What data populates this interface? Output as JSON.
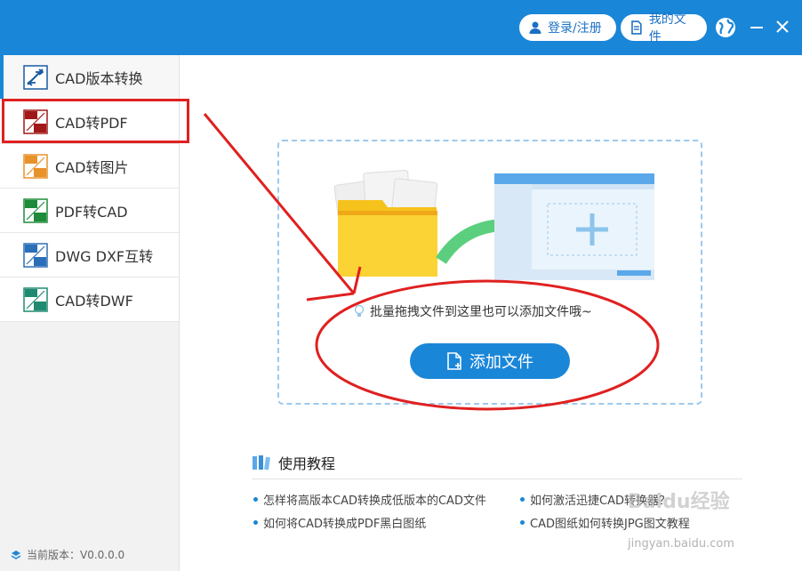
{
  "header": {
    "login_label": "登录/注册",
    "files_label": "我的文件",
    "accent_color": "#1a86d8"
  },
  "sidebar": {
    "items": [
      {
        "label": "CAD版本转换",
        "icon": "cad-version-icon"
      },
      {
        "label": "CAD转PDF",
        "icon": "cad-pdf-icon"
      },
      {
        "label": "CAD转图片",
        "icon": "cad-image-icon"
      },
      {
        "label": "PDF转CAD",
        "icon": "pdf-cad-icon"
      },
      {
        "label": "DWG DXF互转",
        "icon": "dwg-dxf-icon"
      },
      {
        "label": "CAD转DWF",
        "icon": "cad-dwf-icon"
      }
    ],
    "version_text": "当前版本：V0.0.0.0"
  },
  "main": {
    "drop_hint": "批量拖拽文件到这里也可以添加文件哦~",
    "add_button_label": "添加文件",
    "tutorial": {
      "title": "使用教程",
      "links": [
        "怎样将高版本CAD转换成低版本的CAD文件",
        "如何激活迅捷CAD转换器？",
        "如何将CAD转换成PDF黑白图纸",
        "CAD图纸如何转换JPG图文教程"
      ]
    }
  },
  "watermark": {
    "text": "Baidu经验",
    "sub": "jingyan.baidu.com"
  }
}
